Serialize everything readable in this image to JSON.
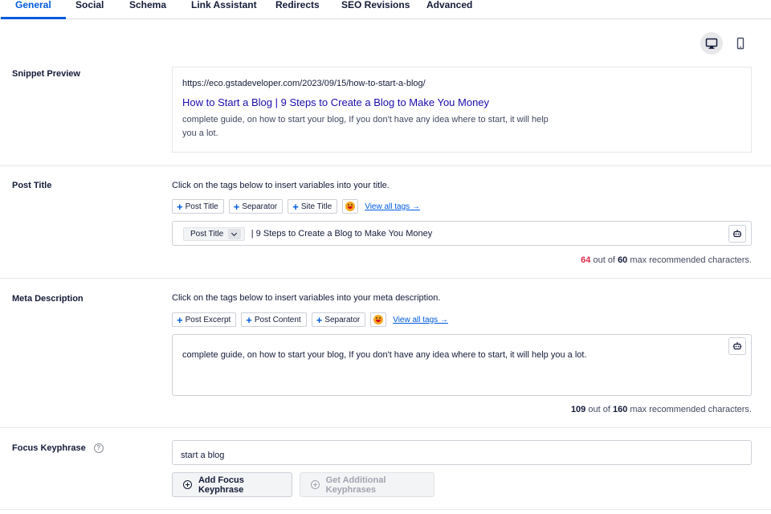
{
  "tabs": [
    {
      "label": "General",
      "active": true
    },
    {
      "label": "Social"
    },
    {
      "label": "Schema"
    },
    {
      "label": "Link Assistant"
    },
    {
      "label": "Redirects"
    },
    {
      "label": "SEO Revisions"
    },
    {
      "label": "Advanced"
    }
  ],
  "device_toggle": {
    "selected": "desktop",
    "icons": [
      "desktop-icon",
      "mobile-icon"
    ]
  },
  "snippet_preview": {
    "label": "Snippet Preview",
    "url": "https://eco.gstadeveloper.com/2023/09/15/how-to-start-a-blog/",
    "title": "How to Start a Blog | 9 Steps to Create a Blog to Make You Money",
    "description": "complete guide, on how to start your blog, If you don't have any idea where to start, it will help you a lot."
  },
  "post_title": {
    "label": "Post Title",
    "hint": "Click on the tags below to insert variables into your title.",
    "tags": [
      "Post Title",
      "Separator",
      "Site Title"
    ],
    "view_all": "View all tags →",
    "pill": "Post Title",
    "value": "| 9 Steps to Create a Blog to Make You Money",
    "count": "64",
    "out_of": "out of",
    "max": "60",
    "suffix": "max recommended characters."
  },
  "meta_description": {
    "label": "Meta Description",
    "hint": "Click on the tags below to insert variables into your meta description.",
    "tags": [
      "Post Excerpt",
      "Post Content",
      "Separator"
    ],
    "view_all": "View all tags →",
    "value": "complete guide, on how to start your blog, If you don't have any idea where to start, it will help you a lot.",
    "count": "109",
    "out_of": "out of",
    "max": "160",
    "suffix": "max recommended characters."
  },
  "focus_keyphrase": {
    "label": "Focus Keyphrase",
    "help": "?",
    "value": "start a blog",
    "add_button": "Add Focus Keyphrase",
    "additional_button": "Get Additional Keyphrases"
  },
  "colors": {
    "accent": "#005ae0",
    "link": "#1a0dab",
    "over_limit": "#df2a4a"
  }
}
